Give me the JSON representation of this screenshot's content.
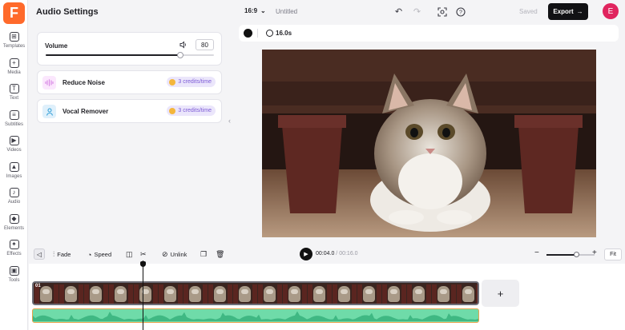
{
  "app": {
    "logo_letter": "F",
    "brand_color": "#ff6a2b"
  },
  "sidebar": {
    "items": [
      {
        "label": "Templates",
        "icon": "templates-icon",
        "glyph": "⊞"
      },
      {
        "label": "Media",
        "icon": "media-icon",
        "glyph": "+"
      },
      {
        "label": "Text",
        "icon": "text-icon",
        "glyph": "T"
      },
      {
        "label": "Subtitles",
        "icon": "subtitles-icon",
        "glyph": "≡"
      },
      {
        "label": "Videos",
        "icon": "videos-icon",
        "glyph": "▶"
      },
      {
        "label": "Images",
        "icon": "images-icon",
        "glyph": "▲"
      },
      {
        "label": "Audio",
        "icon": "audio-icon",
        "glyph": "♪"
      },
      {
        "label": "Elements",
        "icon": "elements-icon",
        "glyph": "◆"
      },
      {
        "label": "Effects",
        "icon": "effects-icon",
        "glyph": "✦"
      },
      {
        "label": "Tools",
        "icon": "tools-icon",
        "glyph": "▣"
      }
    ]
  },
  "panel": {
    "title": "Audio Settings",
    "volume": {
      "label": "Volume",
      "value": "80",
      "level": 0.8
    },
    "features": [
      {
        "label": "Reduce Noise",
        "credits": "3 credits/time",
        "icon": "waveform-icon",
        "icon_color": "#d98ae6",
        "icon_bg": "#fbe7fd"
      },
      {
        "label": "Vocal Remover",
        "credits": "3 credits/time",
        "icon": "person-icon",
        "icon_color": "#3aa2d8",
        "icon_bg": "#dff0fb"
      }
    ]
  },
  "topbar": {
    "ratio": "16:9",
    "title": "Untitled",
    "saved": "Saved",
    "export": "Export",
    "avatar": "E",
    "avatar_color": "#e0245e"
  },
  "canvas_bar": {
    "duration": "16.0s"
  },
  "timeline": {
    "fade": "Fade",
    "speed": "Speed",
    "unlink": "Unlink",
    "current_time": "00:04.0",
    "separator": " / ",
    "total_time": "00:16.0",
    "fit": "Fit",
    "zoom_level": 0.62,
    "clip_number": "01",
    "add": "+"
  }
}
